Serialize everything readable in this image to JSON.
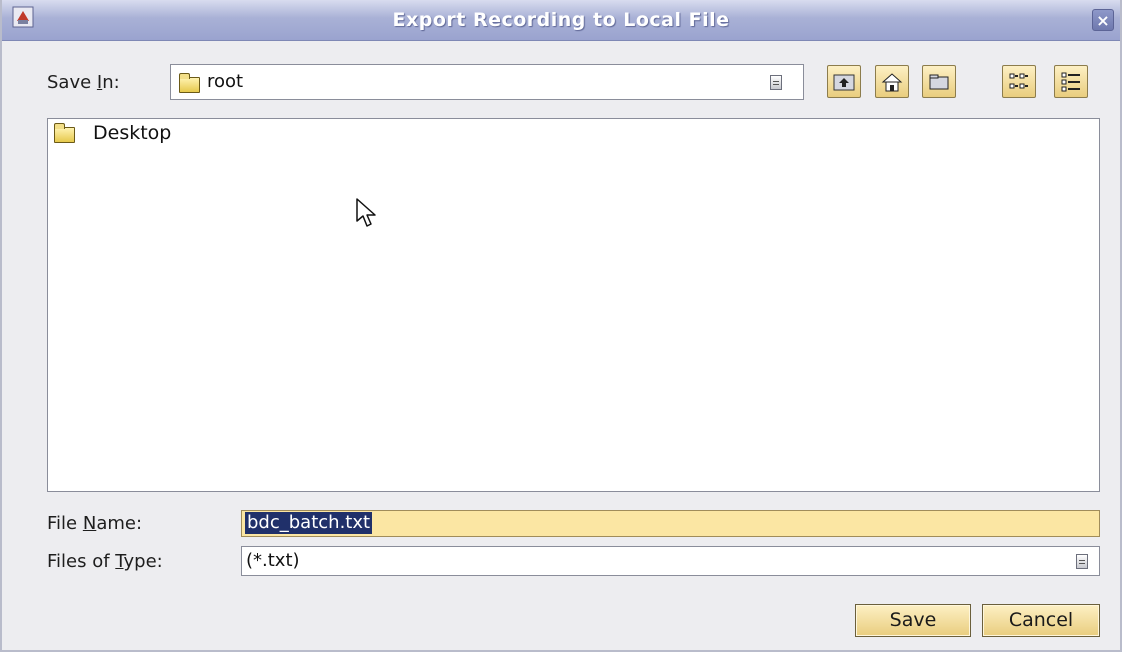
{
  "window": {
    "title": "Export Recording to Local File",
    "close_glyph": "×"
  },
  "save_in": {
    "label": "Save In:",
    "value": "root"
  },
  "toolbar": {
    "icons": [
      "up-one-level-icon",
      "home-icon",
      "new-folder-icon",
      "list-view-icon",
      "details-view-icon"
    ]
  },
  "file_list": {
    "items": [
      {
        "name": "Desktop",
        "icon": "folder-icon"
      }
    ]
  },
  "file_name": {
    "label": "File Name:",
    "value": "bdc_batch.txt"
  },
  "files_of_type": {
    "label": "Files of Type:",
    "value": "(*.txt)"
  },
  "buttons": {
    "save": "Save",
    "cancel": "Cancel"
  }
}
